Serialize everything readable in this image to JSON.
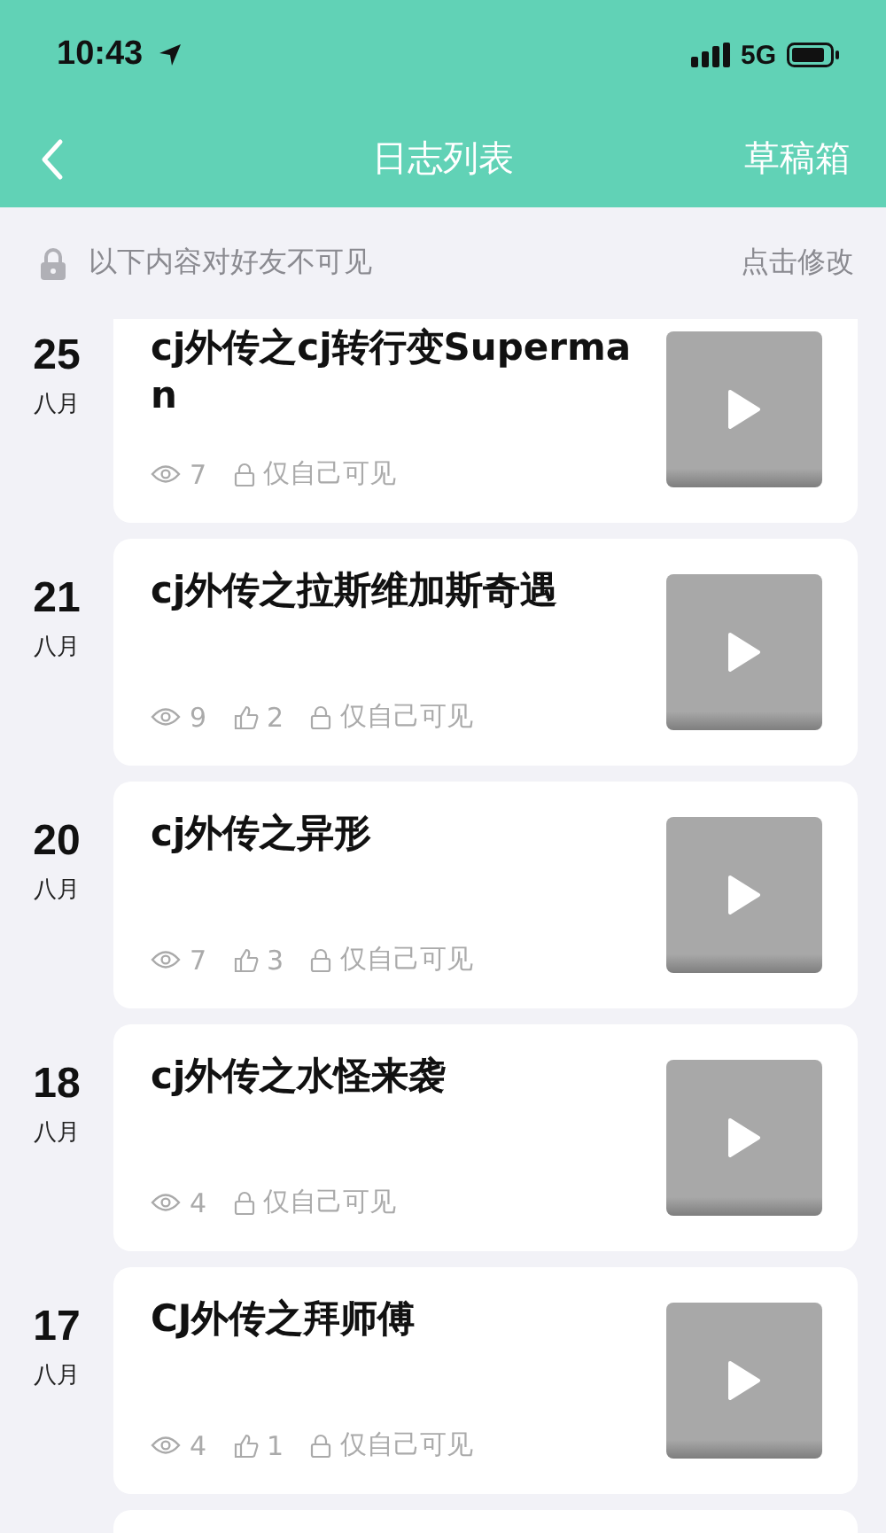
{
  "status_bar": {
    "time": "10:43",
    "network": "5G"
  },
  "nav": {
    "title": "日志列表",
    "action": "草稿箱"
  },
  "notice": {
    "text": "以下内容对好友不可见",
    "action": "点击修改"
  },
  "entries": [
    {
      "day": "25",
      "month": "八月",
      "title": "cj外传之cj转行变Superman",
      "views": "7",
      "privacy": "仅自己可见"
    },
    {
      "day": "21",
      "month": "八月",
      "title": "cj外传之拉斯维加斯奇遇",
      "views": "9",
      "likes": "2",
      "privacy": "仅自己可见"
    },
    {
      "day": "20",
      "month": "八月",
      "title": "cj外传之异形",
      "views": "7",
      "likes": "3",
      "privacy": "仅自己可见"
    },
    {
      "day": "18",
      "month": "八月",
      "title": "cj外传之水怪来袭",
      "views": "4",
      "privacy": "仅自己可见"
    },
    {
      "day": "17",
      "month": "八月",
      "title": "CJ外传之拜师傅",
      "views": "4",
      "likes": "1",
      "privacy": "仅自己可见"
    }
  ]
}
